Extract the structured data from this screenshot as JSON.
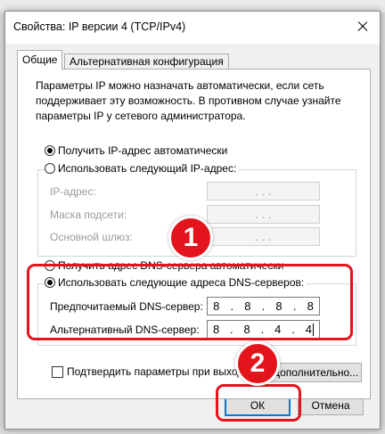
{
  "window": {
    "title": "Свойства: IP версии 4 (TCP/IPv4)"
  },
  "tabs": [
    {
      "label": "Общие",
      "active": true
    },
    {
      "label": "Альтернативная конфигурация",
      "active": false
    }
  ],
  "description": "Параметры IP можно назначать автоматически, если сеть поддерживает эту возможность. В противном случае узнайте параметры IP у сетевого администратора.",
  "ip_section": {
    "auto_label": "Получить IP-адрес автоматически",
    "manual_label": "Использовать следующий IP-адрес:",
    "fields": [
      {
        "label": "IP-адрес:",
        "value": ". . ."
      },
      {
        "label": "Маска подсети:",
        "value": ". . ."
      },
      {
        "label": "Основной шлюз:",
        "value": ". . ."
      }
    ]
  },
  "dns_section": {
    "auto_label": "Получить адрес DNS-сервера автоматически",
    "manual_label": "Использовать следующие адреса DNS-серверов:",
    "preferred": {
      "label": "Предпочитаемый DNS-сервер:",
      "octets": [
        "8",
        "8",
        "8",
        "8"
      ]
    },
    "alternate": {
      "label": "Альтернативный DNS-сервер:",
      "octets": [
        "8",
        "8",
        "4",
        "4"
      ]
    }
  },
  "validate_label": "Подтвердить параметры при выходе",
  "buttons": {
    "advanced": "Дополнительно...",
    "ok": "ОК",
    "cancel": "Отмена"
  },
  "annotations": {
    "badge1": "1",
    "badge2": "2",
    "highlight_color": "#e3141c"
  }
}
